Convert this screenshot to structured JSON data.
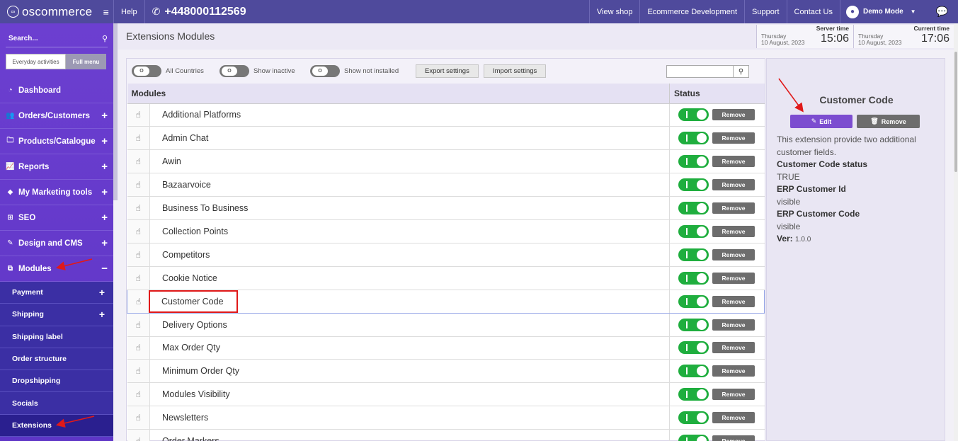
{
  "topbar": {
    "brand": "oscommerce",
    "help": "Help",
    "phone": "+448000112569",
    "links": [
      "View shop",
      "Ecommerce Development",
      "Support",
      "Contact Us"
    ],
    "user": "Demo Mode"
  },
  "sidebar": {
    "search_label": "Search...",
    "switch_a": "Everyday activities",
    "switch_b": "Full menu",
    "items": [
      {
        "label": "Dashboard",
        "icon": "dashboard-icon",
        "expander": ""
      },
      {
        "label": "Orders/Customers",
        "icon": "users-icon",
        "expander": "+"
      },
      {
        "label": "Products/Catalogue",
        "icon": "folder-icon",
        "expander": "+"
      },
      {
        "label": "Reports",
        "icon": "chart-icon",
        "expander": "+"
      },
      {
        "label": "My Marketing tools",
        "icon": "tag-icon",
        "expander": "+"
      },
      {
        "label": "SEO",
        "icon": "sitemap-icon",
        "expander": "+"
      },
      {
        "label": "Design and CMS",
        "icon": "brush-icon",
        "expander": "+"
      },
      {
        "label": "Modules",
        "icon": "puzzle-icon",
        "expander": "−"
      }
    ],
    "subitems": [
      {
        "label": "Payment",
        "expander": "+"
      },
      {
        "label": "Shipping",
        "expander": "+"
      },
      {
        "label": "Shipping label",
        "expander": ""
      },
      {
        "label": "Order structure",
        "expander": ""
      },
      {
        "label": "Dropshipping",
        "expander": ""
      },
      {
        "label": "Socials",
        "expander": ""
      },
      {
        "label": "Extensions",
        "expander": ""
      }
    ]
  },
  "header": {
    "title": "Extensions Modules",
    "server_caption": "Server time",
    "server_day": "Thursday",
    "server_date": "10 August, 2023",
    "server_time": "15:06",
    "current_caption": "Current time",
    "current_day": "Thursday",
    "current_date": "10 August, 2023",
    "current_time": "17:06"
  },
  "toolbar": {
    "toggle_countries": "All Countries",
    "toggle_inactive": "Show inactive",
    "toggle_not_installed": "Show not installed",
    "export": "Export settings",
    "import": "Import settings",
    "search_placeholder": ""
  },
  "table": {
    "col_modules": "Modules",
    "col_status": "Status",
    "remove_label": "Remove",
    "rows": [
      "Additional Platforms",
      "Admin Chat",
      "Awin",
      "Bazaarvoice",
      "Business To Business",
      "Collection Points",
      "Competitors",
      "Cookie Notice",
      "Customer Code",
      "Delivery Options",
      "Max Order Qty",
      "Minimum Order Qty",
      "Modules Visibility",
      "Newsletters",
      "Order Markers"
    ],
    "selected_index": 8
  },
  "detail": {
    "title": "Customer Code",
    "edit": "Edit",
    "remove": "Remove",
    "description": "This extension provide two additional customer fields.",
    "field1_label": "Customer Code status",
    "field1_value": "TRUE",
    "field2_label": "ERP Customer Id",
    "field2_value": "visible",
    "field3_label": "ERP Customer Code",
    "field3_value": "visible",
    "ver_label": "Ver:",
    "ver_value": "1.0.0"
  },
  "colors": {
    "topbar": "#4f4a9c",
    "sidebar": "#6c3fd0",
    "toggle_on": "#1fae3e",
    "annotation": "#e01919"
  }
}
